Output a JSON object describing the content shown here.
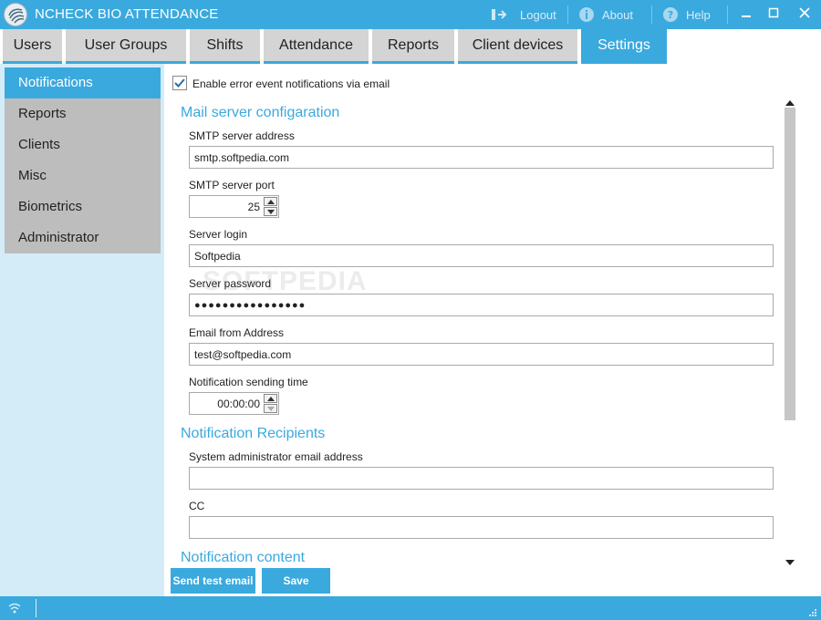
{
  "window": {
    "title": "NCHECK BIO ATTENDANCE",
    "logout_label": "Logout",
    "about_label": "About",
    "help_label": "Help"
  },
  "tabs": [
    {
      "label": "Users"
    },
    {
      "label": "User Groups"
    },
    {
      "label": "Shifts"
    },
    {
      "label": "Attendance"
    },
    {
      "label": "Reports"
    },
    {
      "label": "Client devices"
    },
    {
      "label": "Settings",
      "active": true
    }
  ],
  "sidebar": {
    "items": [
      {
        "label": "Notifications",
        "active": true
      },
      {
        "label": "Reports"
      },
      {
        "label": "Clients"
      },
      {
        "label": "Misc"
      },
      {
        "label": "Biometrics"
      },
      {
        "label": "Administrator"
      }
    ]
  },
  "settings": {
    "enable_label": "Enable error event notifications via email",
    "enable_checked": true,
    "mail_section": "Mail server configaration",
    "smtp_address_label": "SMTP server address",
    "smtp_address_value": "smtp.softpedia.com",
    "smtp_port_label": "SMTP server port",
    "smtp_port_value": "25",
    "login_label": "Server login",
    "login_value": "Softpedia",
    "password_label": "Server password",
    "password_value": "●●●●●●●●●●●●●●●●",
    "from_label": "Email from Address",
    "from_value": "test@softpedia.com",
    "time_label": "Notification sending time",
    "time_value": "00:00:00",
    "recipients_section": "Notification Recipients",
    "admin_email_label": "System administrator email address",
    "admin_email_value": "",
    "cc_label": "CC",
    "cc_value": "",
    "content_section": "Notification content"
  },
  "buttons": {
    "send_test": "Send test email",
    "save": "Save"
  },
  "watermark": "SOFTPEDIA",
  "colors": {
    "accent": "#3aa9de",
    "sidebar_bg": "#d3ecf8",
    "tab_inactive": "#d4d4d4"
  }
}
